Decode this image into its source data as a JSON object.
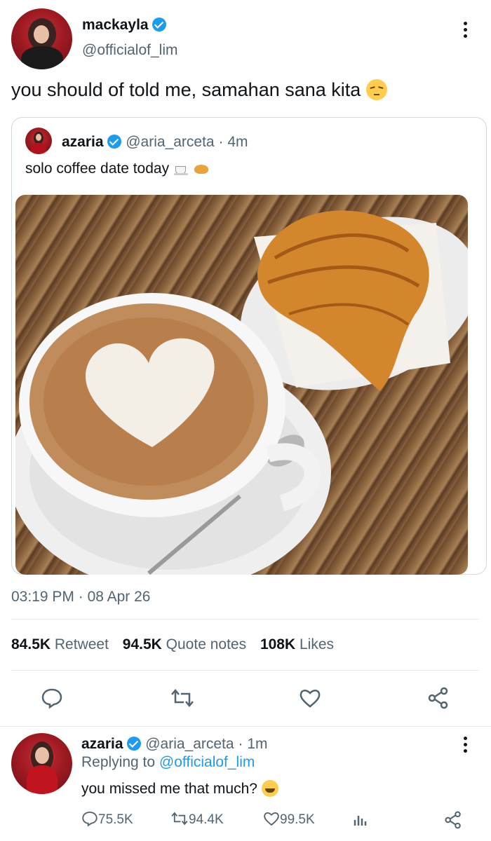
{
  "main_tweet": {
    "author_name": "mackayla",
    "author_handle": "@officialof_lim",
    "text": "you should of told me, samahan sana kita",
    "timestamp": "03:19 PM",
    "date": "08 Apr 26",
    "date_sep": "·"
  },
  "quoted_tweet": {
    "author_name": "azaria",
    "author_handle": "@aria_arceta",
    "age": "4m",
    "sep": "·",
    "text": "solo coffee date today"
  },
  "stats": {
    "retweets_count": "84.5K",
    "retweets_label": "Retweet",
    "quotes_count": "94.5K",
    "quotes_label": "Quote notes",
    "likes_count": "108K",
    "likes_label": "Likes"
  },
  "reply": {
    "author_name": "azaria",
    "author_handle": "@aria_arceta",
    "sep": "·",
    "age": "1m",
    "replying_prefix": "Replying to",
    "replying_handle": "@officialof_lim",
    "text": "you missed me that much?",
    "reply_count": "75.5K",
    "retweet_count": "94.4K",
    "like_count": "99.5K"
  },
  "colors": {
    "accent": "#1d9bf0",
    "text": "#0f1419",
    "secondary": "#536471",
    "border": "#cfd9de"
  },
  "icons": [
    "verified-badge-icon",
    "more-icon",
    "reply-icon",
    "retweet-icon",
    "like-icon",
    "share-icon",
    "analytics-icon",
    "coffee-emoji",
    "croissant-emoji",
    "pensive-emoji",
    "grinning-squinting-emoji"
  ]
}
